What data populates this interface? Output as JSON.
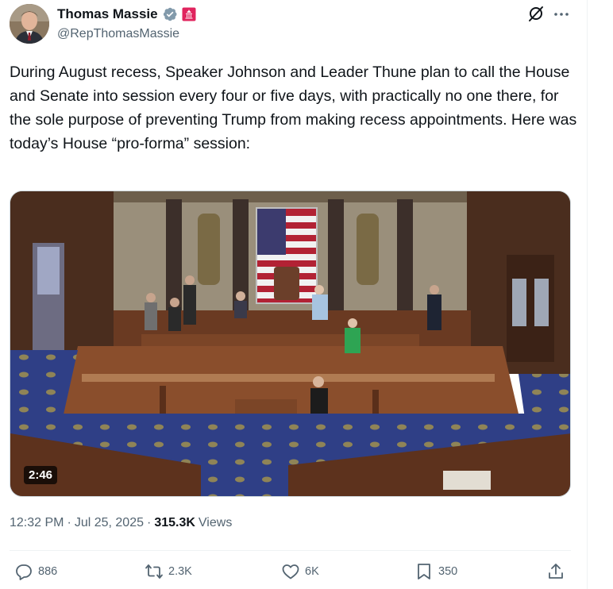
{
  "author": {
    "name": "Thomas Massie",
    "handle": "@RepThomasMassie",
    "verified_color": "#829aab",
    "affiliation_badge_color": "#e0245e"
  },
  "header_icons": [
    "grok-icon",
    "more-icon"
  ],
  "tweet": {
    "text": "During August recess, Speaker Johnson and Leader Thune plan to call the House and Senate into session every four or five days, with practically no one there, for the sole purpose of preventing Trump from making recess appointments. Here was today’s House “pro-forma” session:"
  },
  "media": {
    "type": "video",
    "duration": "2:46"
  },
  "meta": {
    "time": "12:32 PM",
    "separator": "·",
    "date": "Jul 25, 2025",
    "views_count": "315.3K",
    "views_label": "Views"
  },
  "actions": {
    "replies": "886",
    "reposts": "2.3K",
    "likes": "6K",
    "bookmarks": "350"
  },
  "colors": {
    "text_primary": "#0f1419",
    "text_secondary": "#536471",
    "divider": "#eff3f4"
  }
}
